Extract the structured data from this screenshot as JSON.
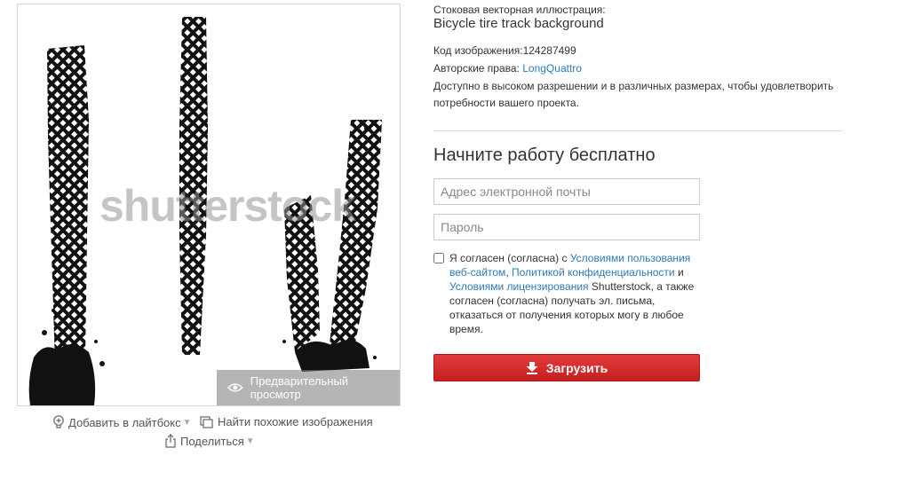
{
  "preview": {
    "watermark_text": "shutterstock",
    "preview_button_label": "Предварительный просмотр"
  },
  "image_actions": {
    "add_to_lightbox": "Добавить в лайтбокс",
    "find_similar": "Найти похожие изображения",
    "share": "Поделиться"
  },
  "image_info": {
    "type_label": "Стоковая векторная иллюстрация:",
    "title": "Bicycle tire track background",
    "image_code_label": "Код изображения:",
    "image_code": "124287499",
    "copyright_label": "Авторские права:",
    "author": "LongQuattro",
    "description": "Доступно в высоком разрешении и в различных размерах, чтобы удовлетворить потребности вашего проекта."
  },
  "signup": {
    "title": "Начните работу бесплатно",
    "email_placeholder": "Адрес электронной почты",
    "password_placeholder": "Пароль",
    "terms_prefix": "Я согласен (согласна) с",
    "terms_link_1": "Условиями пользования веб-сайтом",
    "terms_link_2": "Политикой конфиденциальности",
    "terms_and": "и",
    "terms_link_3": "Условиями лицензирования",
    "terms_suffix": "Shutterstock, а также согласен (согласна) получать эл. письма, отказаться от получения которых могу в любое время.",
    "download_label": "Загрузить"
  },
  "colors": {
    "link": "#2b7bb9",
    "download_button": "#d32f2f"
  }
}
